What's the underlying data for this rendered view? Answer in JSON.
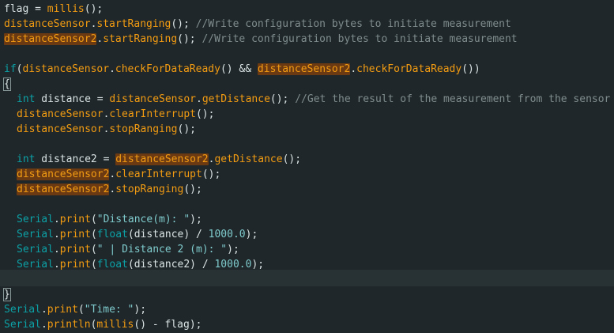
{
  "lines": [
    [
      "flag = ",
      "millis",
      "();"
    ],
    [
      "distanceSensor",
      ".",
      "startRanging",
      "(); ",
      "//Write configuration bytes to initiate measurement"
    ],
    [
      "distanceSensor2",
      ".",
      "startRanging",
      "(); ",
      "//Write configuration bytes to initiate measurement"
    ],
    [],
    [
      "if",
      "(",
      "distanceSensor",
      ".",
      "checkForDataReady",
      "() && ",
      "distanceSensor2",
      ".",
      "checkForDataReady",
      "())"
    ],
    [
      "{"
    ],
    [
      "int",
      " distance = ",
      "distanceSensor",
      ".",
      "getDistance",
      "(); ",
      "//Get the result of the measurement from the sensor"
    ],
    [
      "distanceSensor",
      ".",
      "clearInterrupt",
      "();"
    ],
    [
      "distanceSensor",
      ".",
      "stopRanging",
      "();"
    ],
    [],
    [
      "int",
      " distance2 = ",
      "distanceSensor2",
      ".",
      "getDistance",
      "();"
    ],
    [
      "distanceSensor2",
      ".",
      "clearInterrupt",
      "();"
    ],
    [
      "distanceSensor2",
      ".",
      "stopRanging",
      "();"
    ],
    [],
    [
      "Serial",
      ".",
      "print",
      "(",
      "\"Distance(m): \"",
      ");"
    ],
    [
      "Serial",
      ".",
      "print",
      "(",
      "float",
      "(distance) / ",
      "1000.0",
      ");"
    ],
    [
      "Serial",
      ".",
      "print",
      "(",
      "\" | Distance 2 (m): \"",
      ");"
    ],
    [
      "Serial",
      ".",
      "print",
      "(",
      "float",
      "(distance2) / ",
      "1000.0",
      ");"
    ],
    [],
    [
      "}"
    ],
    [
      "Serial",
      ".",
      "print",
      "(",
      "\"Time: \"",
      ");"
    ],
    [
      "Serial",
      ".",
      "println",
      "(",
      "millis",
      "() - flag);"
    ]
  ],
  "colors": {
    "background": "#1f272a",
    "current_line": "#283235",
    "plain": "#dae3e3",
    "function": "#f39c12",
    "type": "#0ca1a6",
    "string": "#7fcbcd",
    "comment": "#7f8c8d",
    "highlight": "#6b3a12"
  }
}
